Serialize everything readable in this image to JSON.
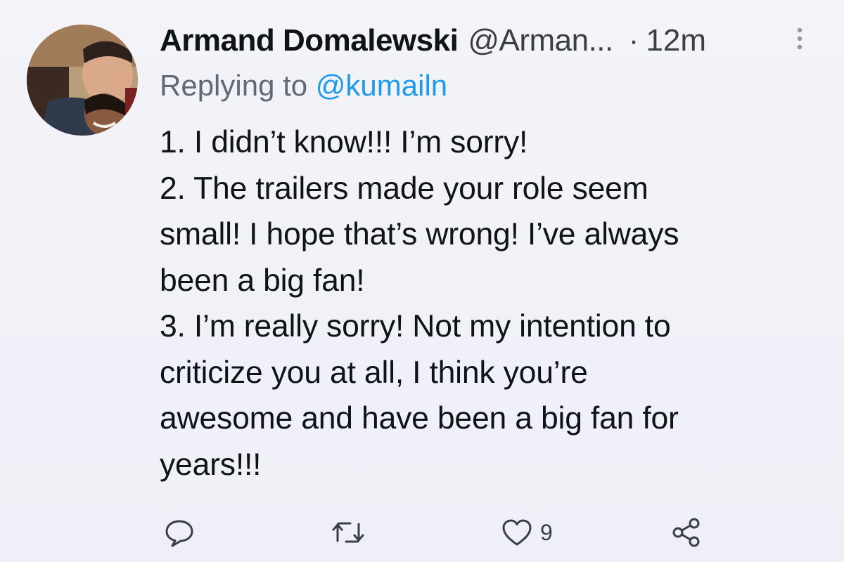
{
  "tweet": {
    "author": {
      "display_name": "Armand Domalewski",
      "handle": "@Arman...",
      "avatar_icon": "profile-photo"
    },
    "separator": "·",
    "timestamp": "12m",
    "reply": {
      "prefix": "Replying to",
      "mention": "@kumailn"
    },
    "body_lines": [
      "1. I didn’t know!!! I’m sorry!",
      "2. The trailers made your role seem",
      "small! I hope that’s wrong! I’ve always",
      "been a big fan!",
      "3. I’m really sorry! Not my intention to",
      "criticize you at all, I think you’re",
      "awesome and have been a big fan for",
      "years!!!"
    ],
    "actions": {
      "reply_icon": "reply-icon",
      "retweet_icon": "retweet-icon",
      "like_icon": "heart-icon",
      "like_count": "9",
      "share_icon": "share-icon"
    }
  },
  "colors": {
    "background": "#f1f1f8",
    "text_primary": "#0f1419",
    "text_secondary": "#5f6a74",
    "link": "#1d9bf0"
  }
}
